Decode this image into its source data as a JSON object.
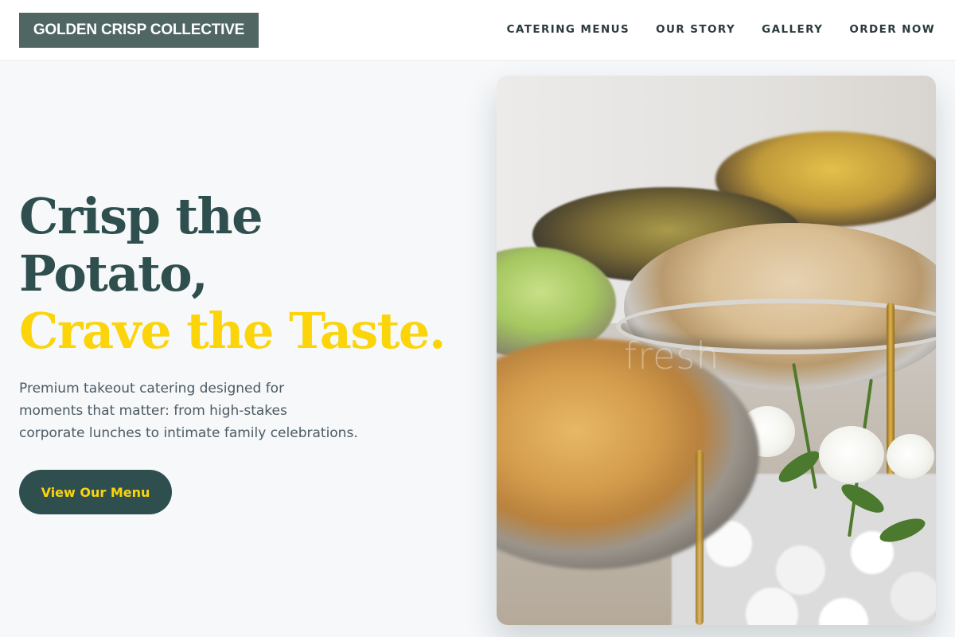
{
  "brand": {
    "logo_text": "GOLDEN CRISP COLLECTIVE"
  },
  "nav": {
    "items": [
      {
        "label": "CATERING MENUS"
      },
      {
        "label": "OUR STORY"
      },
      {
        "label": "GALLERY"
      },
      {
        "label": "ORDER NOW"
      }
    ]
  },
  "hero": {
    "title_line1": "Crisp the",
    "title_line2": "Potato,",
    "title_accent": "Crave the Taste.",
    "subtitle_line1": "Premium takeout catering designed for",
    "subtitle_line2": "moments that matter: from high-stakes",
    "subtitle_line3": "corporate lunches to intimate family celebrations.",
    "cta_label": "View Our Menu",
    "image": {
      "description_icon": "catering-buffet-photo",
      "watermark": "fresh"
    }
  },
  "colors": {
    "brand_dark": "#2f4f4f",
    "logo_bg": "#4f6663",
    "accent": "#fbd40a",
    "page_bg": "#f6f8fa",
    "body_text": "#4b5a63"
  }
}
